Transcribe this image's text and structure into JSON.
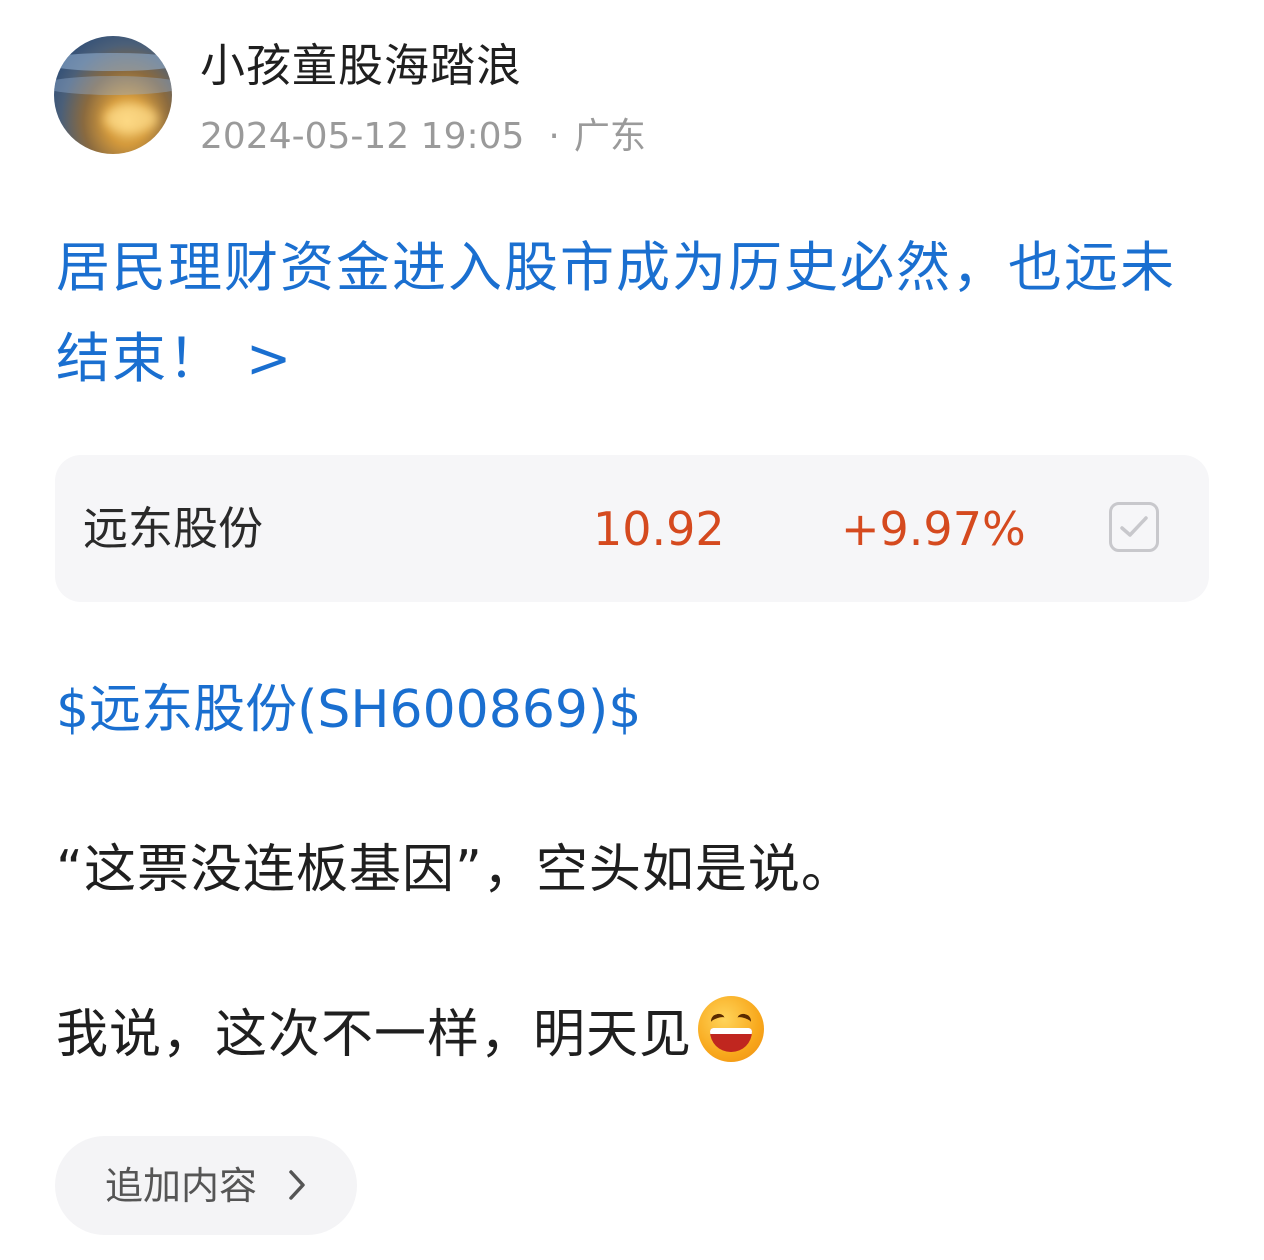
{
  "post": {
    "author": {
      "name": "小孩童股海踏浪",
      "avatar_icon": "avatar-beach-sunset"
    },
    "timestamp": "2024-05-12 19:05",
    "separator": "·",
    "location": "广东",
    "title": "居民理财资金进入股市成为历史必然，也远未结束！",
    "title_chevron": ">",
    "stock_card": {
      "name": "远东股份",
      "price": "10.92",
      "change": "+9.97%",
      "change_color": "#d54a1f",
      "checkbox_icon": "checkbox-check-icon"
    },
    "stock_tag": "$远东股份(SH600869)$",
    "paragraphs": [
      "“这票没连板基因”，空头如是说。",
      "我说，这次不一样，明天见"
    ],
    "emoji_icon": "laughing-face-icon",
    "append_button": {
      "label": "追加内容",
      "icon": "chevron-right-icon"
    }
  },
  "colors": {
    "link_blue": "#1a6fd0",
    "price_red": "#d54a1f",
    "meta_gray": "#9a9a9a",
    "card_bg": "#f6f6f8"
  }
}
